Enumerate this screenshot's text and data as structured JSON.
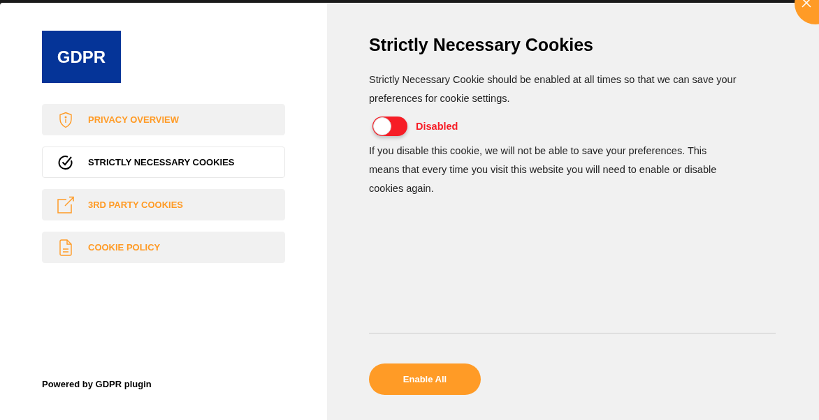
{
  "logo": {
    "text": "GDPR"
  },
  "nav": [
    {
      "label": "PRIVACY OVERVIEW",
      "selected": false
    },
    {
      "label": "STRICTLY NECESSARY COOKIES",
      "selected": true
    },
    {
      "label": "3RD PARTY COOKIES",
      "selected": false
    },
    {
      "label": "COOKIE POLICY",
      "selected": false
    }
  ],
  "footer": {
    "text": "Powered by GDPR plugin"
  },
  "content": {
    "title": "Strictly Necessary Cookies",
    "intro": "Strictly Necessary Cookie should be enabled at all times so that we can save your preferences for cookie settings.",
    "toggle": {
      "on": false,
      "label": "Disabled"
    },
    "note": "If you disable this cookie, we will not be able to save your preferences. This means that every time you visit this website you will need to enable or disable cookies again."
  },
  "button": {
    "label": "Enable All"
  }
}
